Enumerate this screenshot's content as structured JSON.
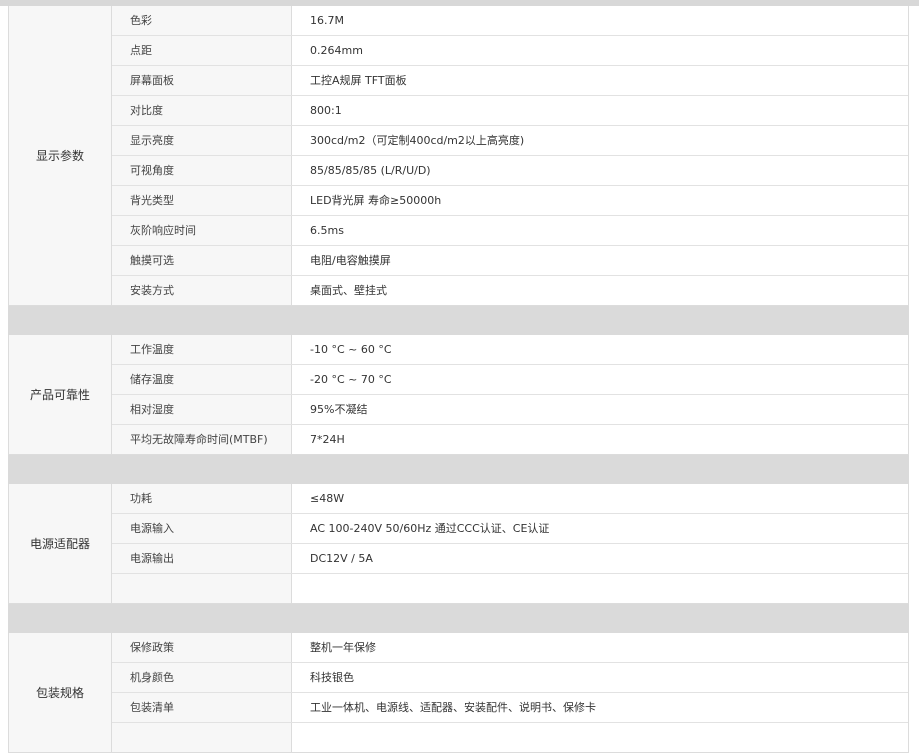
{
  "groups": [
    {
      "label": "显示参数",
      "rows": [
        {
          "key": "色彩",
          "value": "16.7M"
        },
        {
          "key": "点距",
          "value": "0.264mm"
        },
        {
          "key": "屏幕面板",
          "value": "工控A规屏 TFT面板"
        },
        {
          "key": "对比度",
          "value": "800:1"
        },
        {
          "key": "显示亮度",
          "value": "300cd/m2（可定制400cd/m2以上高亮度)"
        },
        {
          "key": "可视角度",
          "value": "85/85/85/85 (L/R/U/D)"
        },
        {
          "key": "背光类型",
          "value": "LED背光屏 寿命≥50000h"
        },
        {
          "key": "灰阶响应时间",
          "value": "6.5ms"
        },
        {
          "key": "触摸可选",
          "value": "电阻/电容触摸屏"
        },
        {
          "key": "安装方式",
          "value": "桌面式、壁挂式"
        }
      ]
    },
    {
      "label": "产品可靠性",
      "rows": [
        {
          "key": "工作温度",
          "value": "-10 °C ~ 60 °C"
        },
        {
          "key": "储存温度",
          "value": "-20 °C ~ 70 °C"
        },
        {
          "key": "相对湿度",
          "value": "95%不凝结"
        },
        {
          "key": "平均无故障寿命时间(MTBF)",
          "value": "7*24H"
        }
      ]
    },
    {
      "label": "电源适配器",
      "rows": [
        {
          "key": "功耗",
          "value": "≤48W"
        },
        {
          "key": "电源输入",
          "value": "AC 100-240V  50/60Hz 通过CCC认证、CE认证"
        },
        {
          "key": "电源输出",
          "value": "DC12V / 5A"
        },
        {
          "key": "",
          "value": ""
        }
      ]
    },
    {
      "label": "包装规格",
      "rows": [
        {
          "key": "保修政策",
          "value": "整机一年保修"
        },
        {
          "key": "机身颜色",
          "value": "科技银色"
        },
        {
          "key": "包装清单",
          "value": "工业一体机、电源线、适配器、安装配件、说明书、保修卡"
        },
        {
          "key": "",
          "value": ""
        }
      ]
    }
  ]
}
